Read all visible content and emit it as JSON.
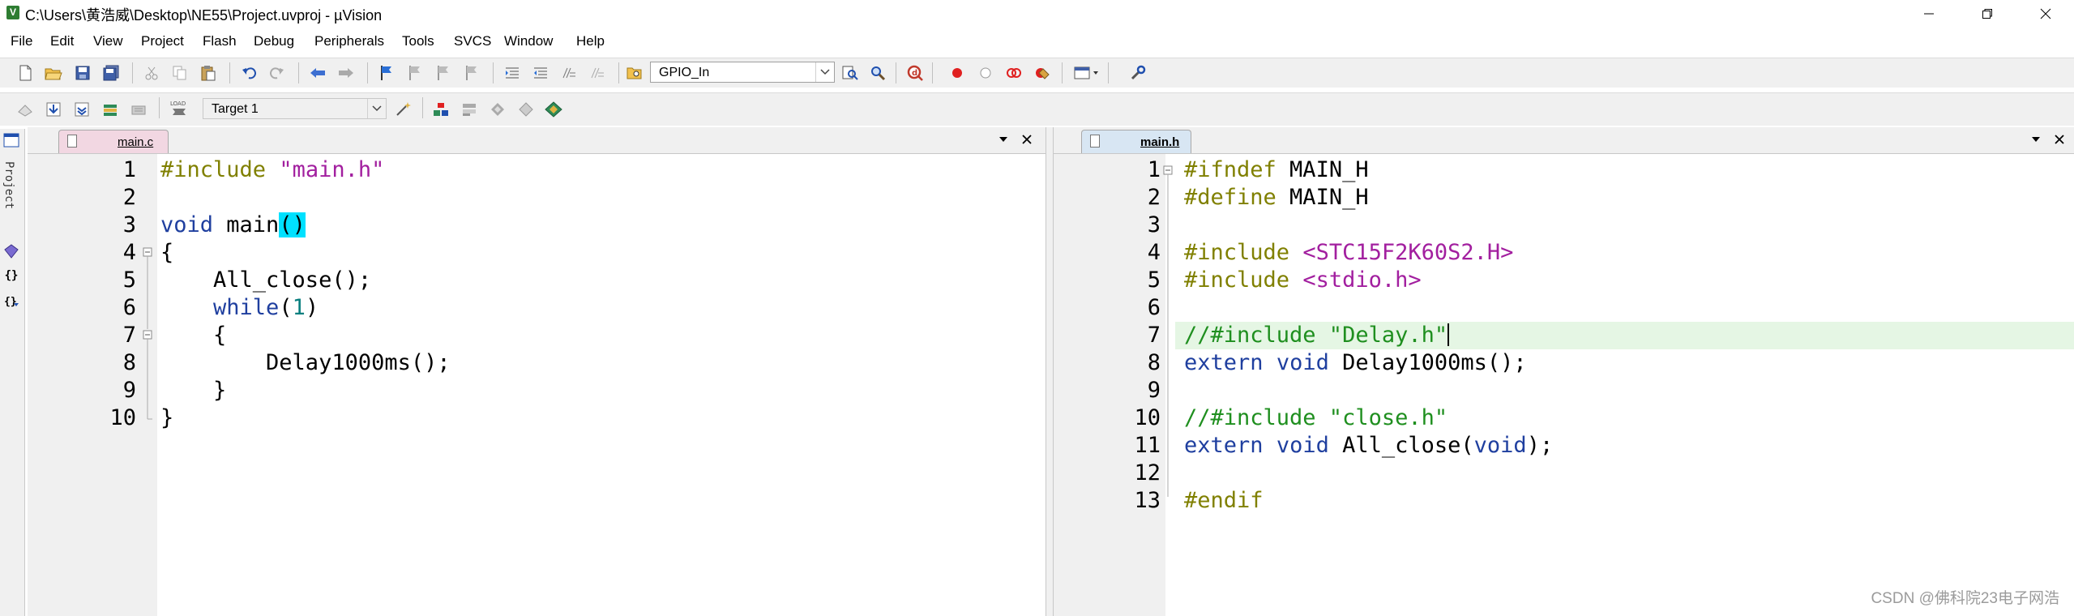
{
  "window": {
    "title": "C:\\Users\\黄浩威\\Desktop\\NE55\\Project.uvproj - µVision",
    "app_icon_letter": "V"
  },
  "menu": [
    {
      "label": "File"
    },
    {
      "label": "Edit"
    },
    {
      "label": "View"
    },
    {
      "label": "Project"
    },
    {
      "label": "Flash"
    },
    {
      "label": "Debug"
    },
    {
      "label": "Peripherals"
    },
    {
      "label": "Tools"
    },
    {
      "label": "SVCS"
    },
    {
      "label": "Window"
    },
    {
      "label": "Help"
    }
  ],
  "toolbar1": {
    "find_combo_value": "GPIO_In"
  },
  "toolbar2": {
    "target_combo_value": "Target 1",
    "load_label": "LOAD"
  },
  "side_panel": {
    "project_label": "Project"
  },
  "left_pane": {
    "tab_label": "main.c",
    "line_numbers": [
      "1",
      "2",
      "3",
      "4",
      "5",
      "6",
      "7",
      "8",
      "9",
      "10"
    ],
    "lines": {
      "l1_directive": "#include",
      "l1_string": "\"main.h\"",
      "l3_type": "void",
      "l3_name": " main",
      "l3_parens": "()",
      "l4_brace": "{",
      "l5_call": "    All_close();",
      "l6_kw": "while",
      "l6_open": "(",
      "l6_num": "1",
      "l6_close": ")",
      "l7_brace": "    {",
      "l8_call": "        Delay1000ms();",
      "l9_brace": "    }",
      "l10_brace": "}"
    }
  },
  "right_pane": {
    "tab_label": "main.h",
    "line_numbers": [
      "1",
      "2",
      "3",
      "4",
      "5",
      "6",
      "7",
      "8",
      "9",
      "10",
      "11",
      "12",
      "13"
    ],
    "lines": {
      "l1_directive": "#ifndef",
      "l1_name": " MAIN_H",
      "l2_directive": "#define",
      "l2_name": " MAIN_H",
      "l4_directive": "#include",
      "l4_header": "<STC15F2K60S2.H>",
      "l5_directive": "#include",
      "l5_header": "<stdio.h>",
      "l7_comment": "//#include \"Delay.h\"",
      "l8_extern": "extern",
      "l8_void": "void",
      "l8_name": " Delay1000ms();",
      "l10_comment": "//#include \"close.h\"",
      "l11_extern": "extern",
      "l11_void": "void",
      "l11_name": " All_close(",
      "l11_param": "void",
      "l11_end": ");",
      "l13_directive": "#endif"
    }
  },
  "watermark": "CSDN @佛科院23电子网浩",
  "colors": {
    "preprocessor": "#808000",
    "keyword": "#1f3f9f",
    "string": "#a21f9f",
    "number": "#0a7f7f",
    "comment": "#1f8f1f",
    "brace_highlight": "#00e1ff",
    "current_line": "#e5f6e4"
  }
}
